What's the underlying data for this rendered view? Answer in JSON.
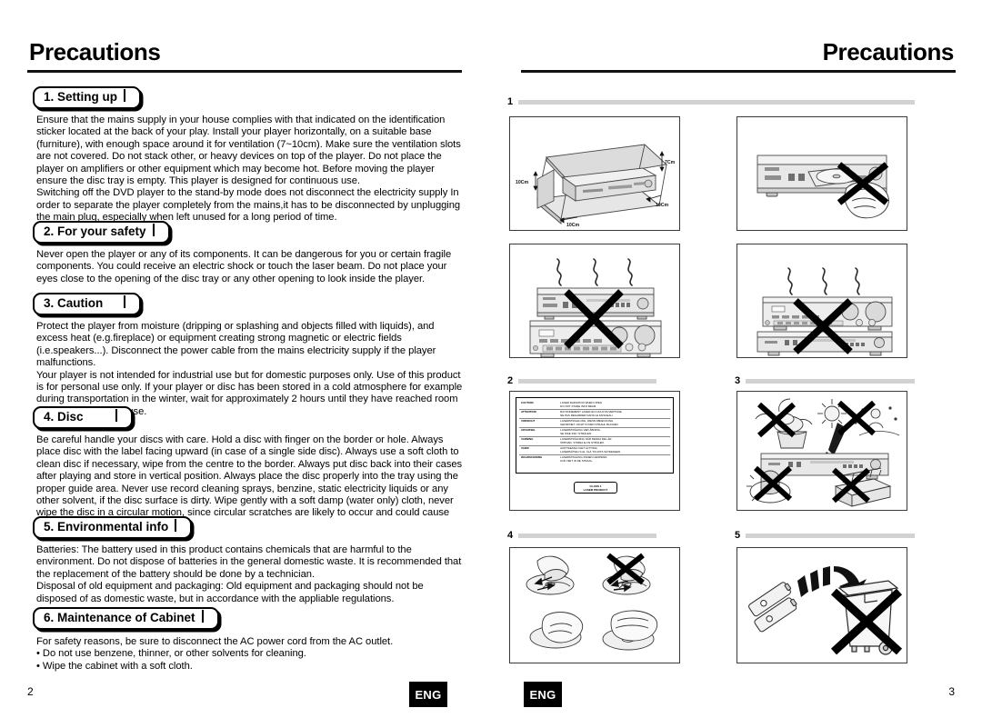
{
  "document": {
    "left_page": {
      "header_title": "Precautions",
      "folio": "2",
      "language_badge": "ENG",
      "sections": [
        {
          "heading": "1. Setting up",
          "paragraphs": [
            "Ensure that the mains supply in your house complies with that indicated on the identification sticker located at the back of your play. Install  your player horizontally, on a suitable base (furniture), with enough space around it for ventilation (7~10cm). Make sure the ventilation slots are not covered. Do not stack other, or heavy devices on top of the player. Do not place the player on amplifiers or other equipment which may become hot. Before moving the player ensure the disc tray is empty. This player is designed for continuous use.",
            "Switching off the DVD player to the stand-by mode does not disconnect the electricity supply In order to separate the player completely from the mains,it has to be disconnected by unplugging the main plug, especially when left unused for a long period of time."
          ]
        },
        {
          "heading": "2. For your safety",
          "paragraphs": [
            "Never open the player or any of its components. It can be dangerous for you or certain fragile components. You could receive an electric shock or touch the laser beam. Do not place your eyes close to the opening of the disc tray or any other opening to look inside the player."
          ]
        },
        {
          "heading": "3. Caution",
          "paragraphs": [
            "Protect the player from moisture (dripping or splashing and objects filled with liquids), and excess heat (e.g.fireplace) or equipment creating strong magnetic or electric fields (i.e.speakers...). Disconnect the power cable from the mains electricity supply if the player malfunctions.",
            "Your player is not intended for industrial use but  for domestic purposes only. Use of this product is for personal use only. If your player or disc has been stored in a cold atmosphere for example during transportation in the winter, wait for approximately 2 hours until they have reached room temperature, before use."
          ]
        },
        {
          "heading": "4. Disc",
          "paragraphs": [
            "Be careful handle your discs with care. Hold a disc with finger on the border or hole. Always place disc with the label facing upward (in case of a single side disc). Always use a soft cloth to clean disc if necessary, wipe from the centre to the border. Always put disc back into their cases after playing and store in vertical position. Always place the disc properly into the tray using the proper guide area. Never use record cleaning sprays, benzine, static electricity liquids or any other solvent, if the disc surface is dirty. Wipe gently with a soft damp (water only) cloth, never wipe the disc in a circular motion, since circular scratches are likely to occur and could cause noise during playback."
          ]
        },
        {
          "heading": "5. Environmental info",
          "paragraphs": [
            "Batteries: The battery used in this product contains chemicals that are harmful to the environment. Do not dispose of batteries in the general domestic waste. It is recommended that the replacement of the battery should be done by a technician.",
            "Disposal of old equipment and packaging: Old equipment and packaging should not be disposed of as domestic waste, but in accordance with the appliable regulations."
          ]
        },
        {
          "heading": "6. Maintenance of Cabinet",
          "paragraphs": [
            "For safety reasons, be sure to disconnect the AC power cord from the AC outlet.",
            "• Do not use benzene, thinner, or other solvents for cleaning.",
            "• Wipe the cabinet with a soft cloth."
          ]
        }
      ]
    },
    "right_page": {
      "header_title": "Precautions",
      "folio": "3",
      "language_badge": "ENG",
      "figure_groups": [
        {
          "number": "1"
        },
        {
          "number": "2"
        },
        {
          "number": "3"
        },
        {
          "number": "4"
        },
        {
          "number": "5"
        }
      ],
      "figures": {
        "ventilation": {
          "caption_labels": [
            "10Cm",
            "7Cm",
            "10Cm",
            "10Cm"
          ]
        },
        "laser_label": {
          "rows": [
            {
              "lang": "CAUTION",
              "text": "LASER RADIATION WHEN OPEN\nDO NOT STARE INFO BEAM"
            },
            {
              "lang": "ATTENTION",
              "text": "RAYONNEMENT LASER EN CAS D'OUVERTURE.\nNE PAS REGARDER DANS LE FAISCEAU."
            },
            {
              "lang": "VORSICHT",
              "text": "LASERSTRAHLUNG, WENN ABDECKUNG\nGEÖFFNET. NICHT IN DEN STRAHL BLICKEN."
            },
            {
              "lang": "ADVARSEL",
              "text": "LASERSTRÅLING VED ÅBNING.\nSE IKKE IND I STRÅLEN."
            },
            {
              "lang": "VARNING",
              "text": "LASERSTRÅLNING NÄR DENNA DEL ÄR\nÖPPNAD. STIRRA EJ IN STRÅLEN."
            },
            {
              "lang": "VARO!",
              "text": "AVATTAESSA OLET ALTTIINA\nLASERSÄTEILYLLE. ÄLÄ TUIJOTA SÄTEESEEN."
            },
            {
              "lang": "WAARSCHWING",
              "text": "LASERSTRALING INDIEN GEOPEND.\nKIJK NIET IN DE STRAAL."
            }
          ],
          "class_mark": "CLASS 1\nLASER PRODUCT"
        }
      }
    }
  },
  "colors": {
    "ink": "#000000",
    "rule": "#111111",
    "bar_gray": "#d2d2d2",
    "figure_border": "#3a3a3a",
    "device_body": "#e4e4e4",
    "device_shade": "#bdbdbd"
  }
}
